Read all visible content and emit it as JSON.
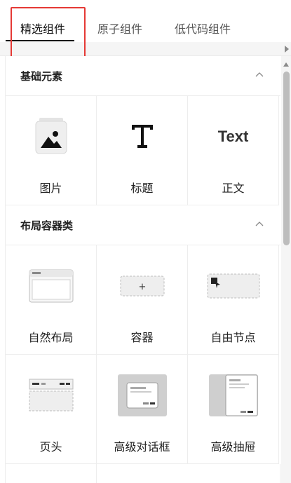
{
  "tabs": [
    {
      "label": "精选组件",
      "active": true
    },
    {
      "label": "原子组件",
      "active": false
    },
    {
      "label": "低代码组件",
      "active": false
    }
  ],
  "sections": [
    {
      "title": "基础元素",
      "items": [
        {
          "label": "图片",
          "icon": "image-icon"
        },
        {
          "label": "标题",
          "icon": "heading-T-icon"
        },
        {
          "label": "正文",
          "icon": "text-icon",
          "icon_text": "Text"
        }
      ]
    },
    {
      "title": "布局容器类",
      "items": [
        {
          "label": "自然布局",
          "icon": "natural-layout-icon"
        },
        {
          "label": "容器",
          "icon": "container-icon",
          "icon_text": "+"
        },
        {
          "label": "自由节点",
          "icon": "free-node-icon"
        },
        {
          "label": "页头",
          "icon": "page-header-icon"
        },
        {
          "label": "高级对话框",
          "icon": "advanced-dialog-icon"
        },
        {
          "label": "高级抽屉",
          "icon": "advanced-drawer-icon"
        }
      ]
    }
  ],
  "colors": {
    "highlight": "#e53935",
    "active_underline": "#111111",
    "border": "#ededed"
  }
}
